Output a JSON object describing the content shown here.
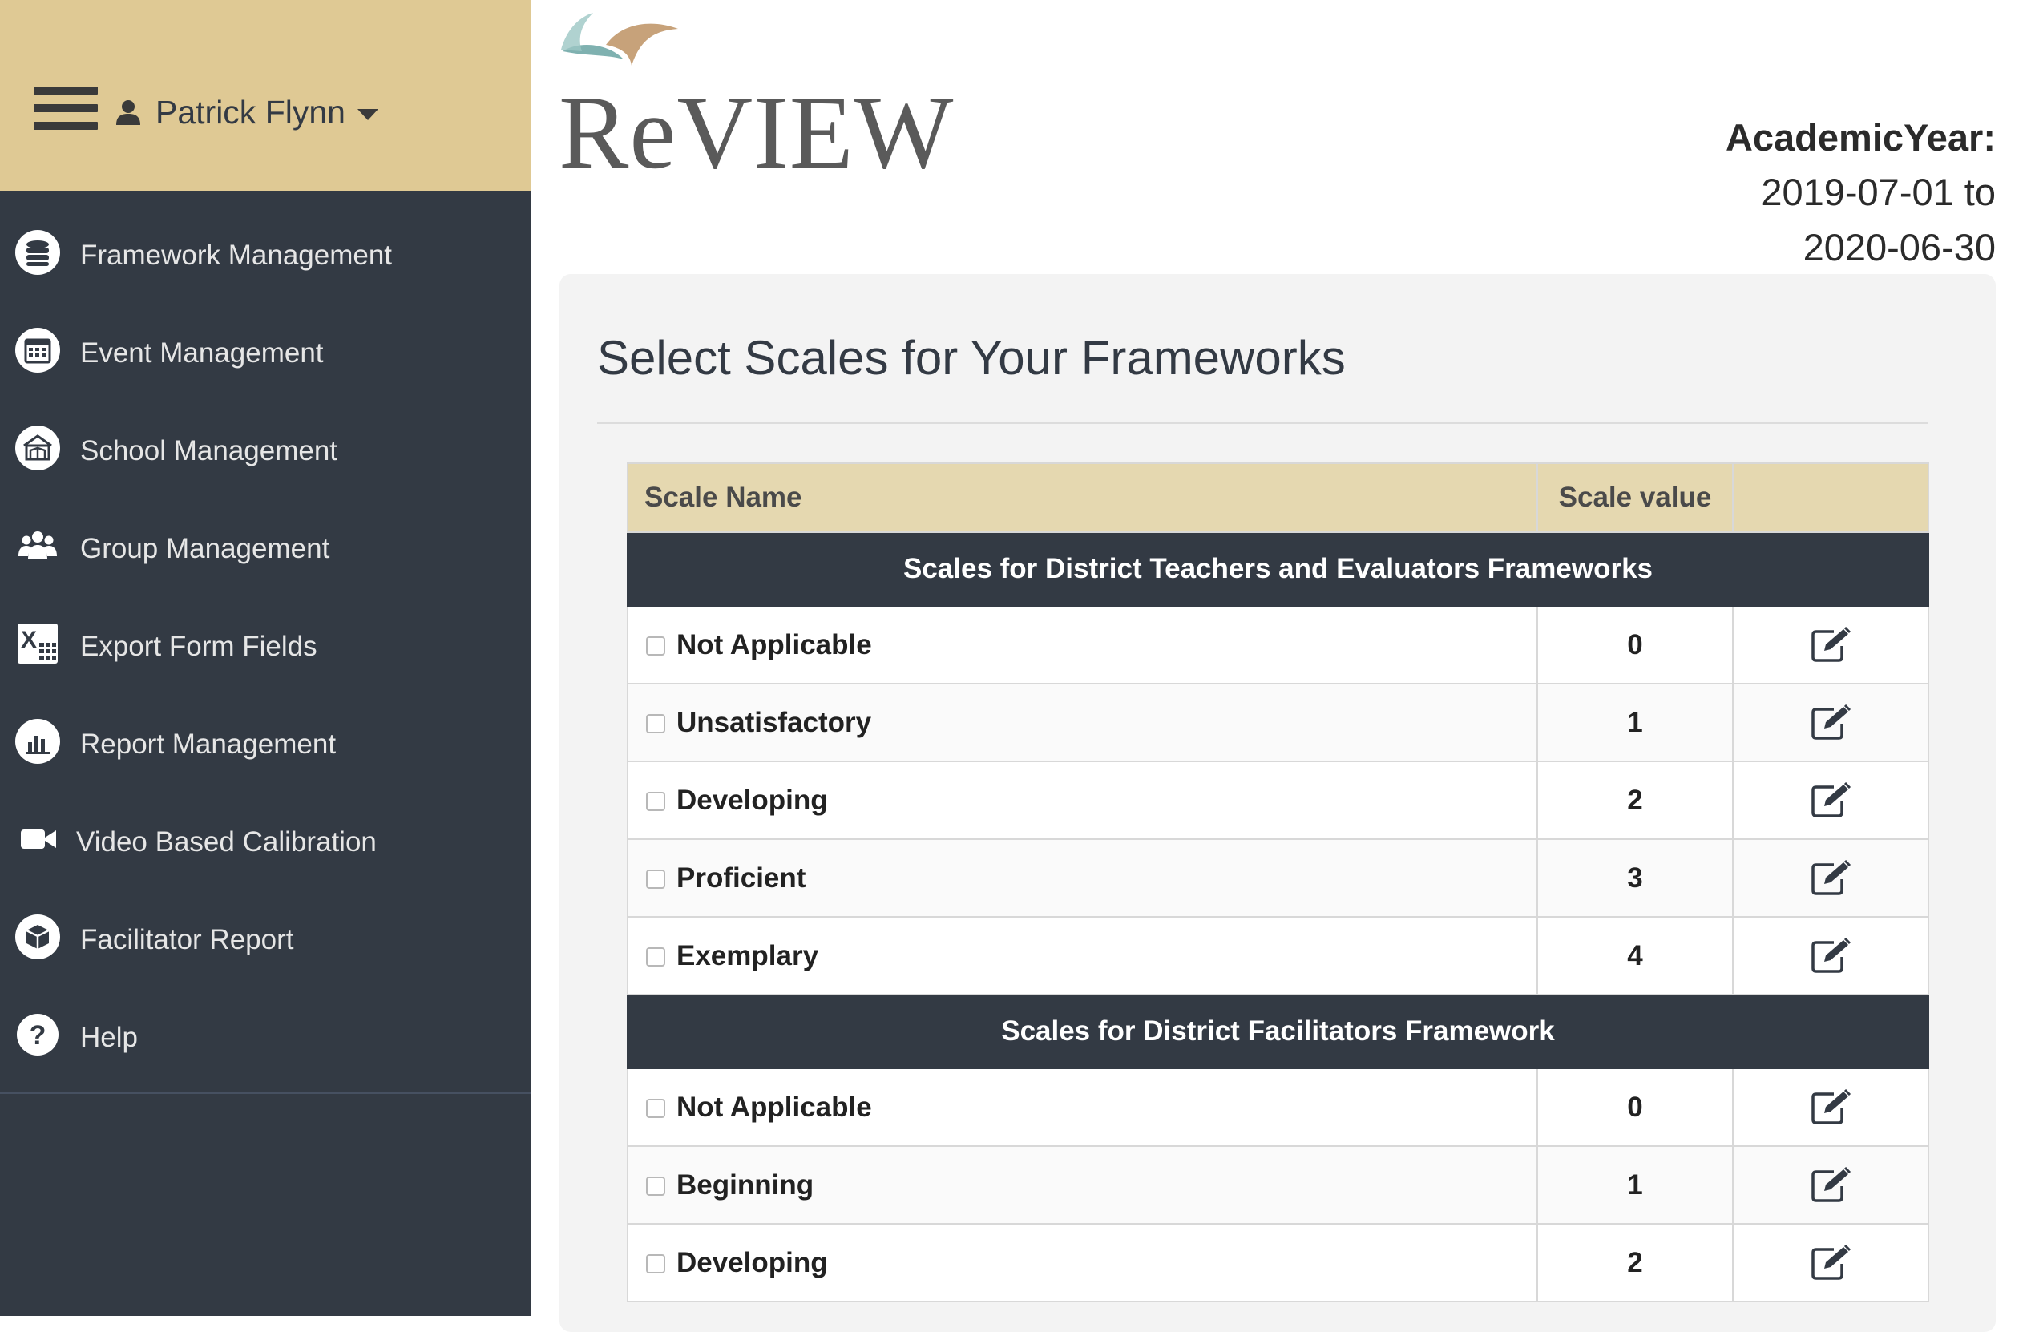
{
  "user": {
    "name": "Patrick Flynn"
  },
  "nav": {
    "items": [
      {
        "label": "Framework Management",
        "icon": "database-icon"
      },
      {
        "label": "Event Management",
        "icon": "calendar-icon"
      },
      {
        "label": "School Management",
        "icon": "school-icon"
      },
      {
        "label": "Group Management",
        "icon": "group-icon"
      },
      {
        "label": "Export Form Fields",
        "icon": "excel-icon"
      },
      {
        "label": "Report Management",
        "icon": "bar-chart-icon"
      },
      {
        "label": "Video Based Calibration",
        "icon": "video-camera-icon"
      },
      {
        "label": "Facilitator Report",
        "icon": "cube-icon"
      },
      {
        "label": "Help",
        "icon": "help-icon"
      }
    ]
  },
  "header": {
    "logo_text": "ReVIEW",
    "academic_year_label": "AcademicYear:",
    "academic_year_start": "2019-07-01 to",
    "academic_year_end": "2020-06-30"
  },
  "main": {
    "title": "Select Scales for Your Frameworks",
    "table": {
      "columns": [
        "Scale Name",
        "Scale value",
        ""
      ],
      "groups": [
        {
          "title": "Scales for District Teachers and Evaluators Frameworks",
          "rows": [
            {
              "name": "Not Applicable",
              "value": "0"
            },
            {
              "name": "Unsatisfactory",
              "value": "1"
            },
            {
              "name": "Developing",
              "value": "2"
            },
            {
              "name": "Proficient",
              "value": "3"
            },
            {
              "name": "Exemplary",
              "value": "4"
            }
          ]
        },
        {
          "title": "Scales for District Facilitators Framework",
          "rows": [
            {
              "name": "Not Applicable",
              "value": "0"
            },
            {
              "name": "Beginning",
              "value": "1"
            },
            {
              "name": "Developing",
              "value": "2"
            }
          ]
        }
      ]
    }
  },
  "colors": {
    "sidebar": "#333a44",
    "accent_gold": "#dfc994",
    "table_header": "#e5d8b0"
  }
}
